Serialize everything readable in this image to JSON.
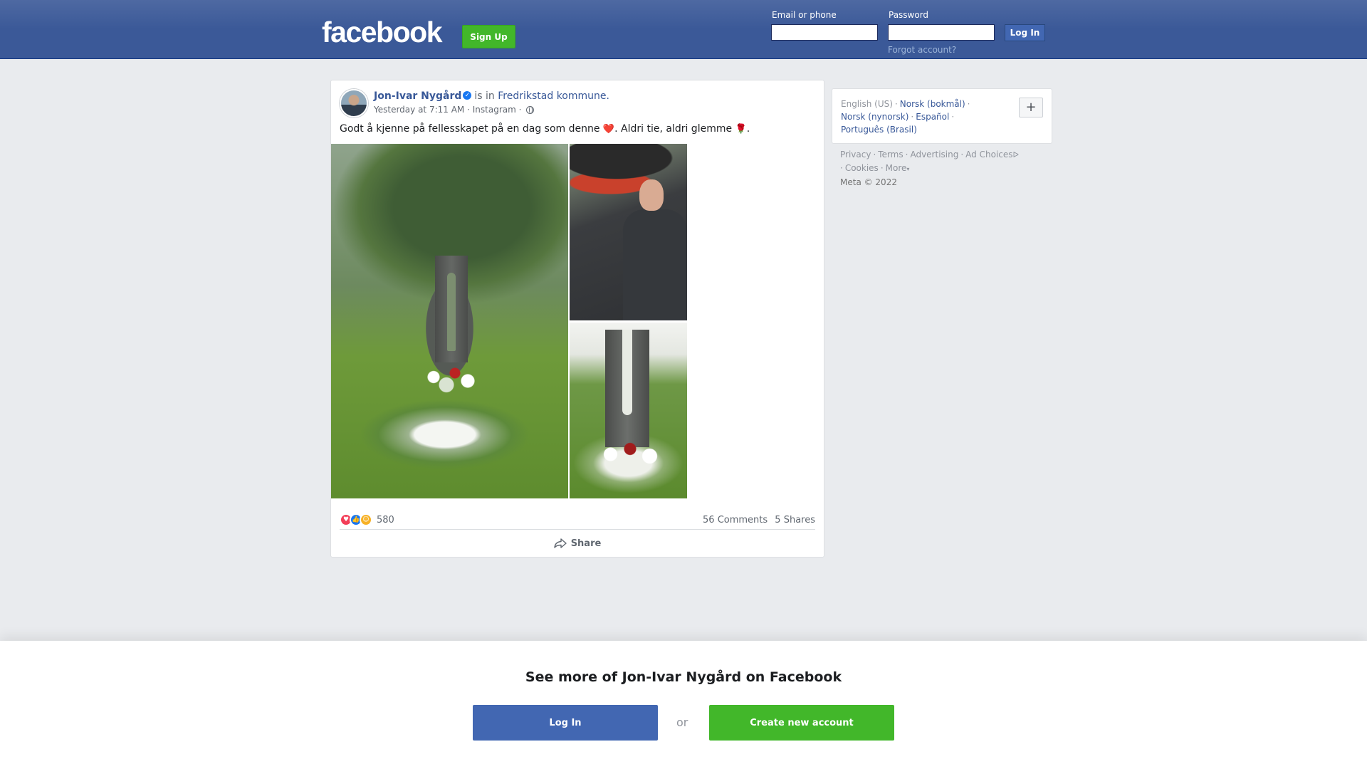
{
  "header": {
    "logo": "facebook",
    "signup_label": "Sign Up",
    "email_label": "Email or phone",
    "password_label": "Password",
    "login_label": "Log In",
    "forgot_label": "Forgot account?"
  },
  "post": {
    "author": "Jon-Ivar Nygård",
    "verified_mark": "✓",
    "is_in": "is in",
    "place": "Fredrikstad kommune.",
    "time": "Yesterday at 7:11 AM",
    "source": "Instagram",
    "dot": "·",
    "text_before_heart": "Godt å kjenne på fellesskapet på en dag som denne ",
    "heart": "❤️",
    "text_middle": ". Aldri tie, aldri glemme ",
    "rose": "🌹",
    "text_end": ".",
    "reaction_count": "580",
    "comments": "56 Comments",
    "shares": "5 Shares",
    "share_label": "Share"
  },
  "languages": {
    "current": "English (US)",
    "links": [
      "Norsk (bokmål)",
      "Norsk (nynorsk)",
      "Español",
      "Português (Brasil)"
    ],
    "plus": "+"
  },
  "footer": {
    "links": [
      "Privacy",
      "Terms",
      "Advertising",
      "Ad Choices",
      "Cookies",
      "More"
    ],
    "adchoices_glyph": "ᐅ",
    "more_glyph": "▾",
    "copyright": "Meta © 2022"
  },
  "banner": {
    "title": "See more of Jon-Ivar Nygård on Facebook",
    "login_label": "Log In",
    "or_label": "or",
    "create_label": "Create new account"
  },
  "colors": {
    "brand_blue": "#3b5998",
    "link_blue": "#385898",
    "button_blue": "#4267b2",
    "green": "#42b72a",
    "background": "#e9ebee"
  }
}
